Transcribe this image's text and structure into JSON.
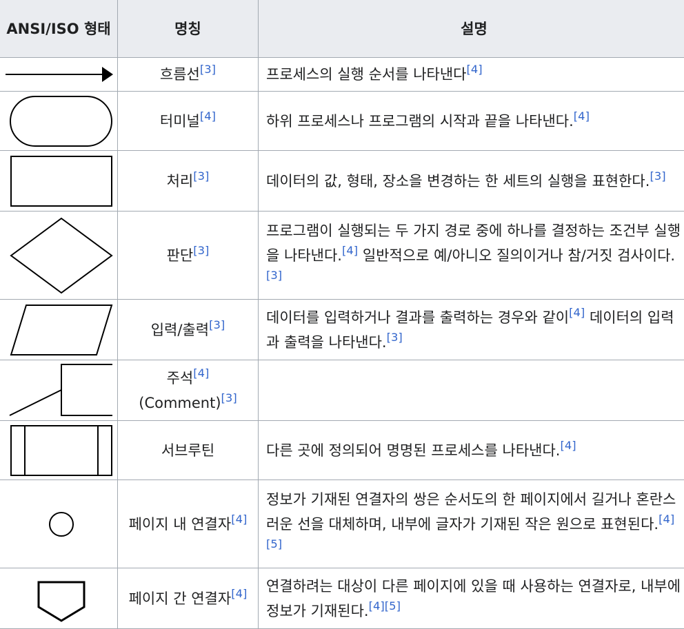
{
  "table": {
    "headers": [
      "ANSI/ISO 형태",
      "명칭",
      "설명"
    ],
    "rows": [
      {
        "shape_icon": "arrow-icon",
        "name": "흐름선",
        "name_refs": [
          "[3]"
        ],
        "desc": "프로세스의 실행 순서를 나타낸다",
        "desc_refs": [
          "[4]"
        ]
      },
      {
        "shape_icon": "terminal-icon",
        "name": "터미널",
        "name_refs": [
          "[4]"
        ],
        "desc": "하위 프로세스나 프로그램의 시작과 끝을 나타낸다.",
        "desc_refs": [
          "[4]"
        ]
      },
      {
        "shape_icon": "process-rectangle-icon",
        "name": "처리",
        "name_refs": [
          "[3]"
        ],
        "desc": "데이터의 값, 형태, 장소을 변경하는 한 세트의 실행을 표현한다.",
        "desc_refs": [
          "[3]"
        ]
      },
      {
        "shape_icon": "decision-diamond-icon",
        "name": "판단",
        "name_refs": [
          "[3]"
        ],
        "desc": "프로그램이 실행되는 두 가지 경로 중에 하나를 결정하는 조건부 실행을 나타낸다.",
        "desc_mid_refs": [
          "[4]"
        ],
        "desc2": " 일반적으로 예/아니오 질의이거나 참/거짓 검사이다.",
        "desc_refs": [
          "[3]"
        ]
      },
      {
        "shape_icon": "io-parallelogram-icon",
        "name": "입력/출력",
        "name_refs": [
          "[3]"
        ],
        "desc": "데이터를 입력하거나 결과를 출력하는 경우와 같이",
        "desc_mid_refs": [
          "[4]"
        ],
        "desc2": " 데이터의 입력과 출력을 나타낸다.",
        "desc_refs": [
          "[3]"
        ]
      },
      {
        "shape_icon": "comment-icon",
        "name": "주석",
        "name_refs": [
          "[4]"
        ],
        "name2": "(Comment)",
        "name2_refs": [
          "[3]"
        ],
        "desc": "",
        "desc_refs": []
      },
      {
        "shape_icon": "subroutine-icon",
        "name": "서브루틴",
        "name_refs": [],
        "desc": "다른 곳에 정의되어 명명된 프로세스를 나타낸다.",
        "desc_refs": [
          "[4]"
        ]
      },
      {
        "shape_icon": "on-page-connector-icon",
        "name": "페이지 내 연결자",
        "name_refs": [
          "[4]"
        ],
        "desc": "정보가 기재된 연결자의 쌍은 순서도의 한 페이지에서 길거나 혼란스러운 선을 대체하며, 내부에 글자가 기재된 작은 원으로 표현된다.",
        "desc_refs": [
          "[4]",
          "[5]"
        ]
      },
      {
        "shape_icon": "off-page-connector-icon",
        "name": "페이지 간 연결자",
        "name_refs": [
          "[4]"
        ],
        "desc": "연결하려는 대상이 다른 페이지에 있을 때 사용하는 연결자로, 내부에 정보가 기재된다.",
        "desc_refs": [
          "[4]",
          "[5]"
        ]
      }
    ]
  }
}
